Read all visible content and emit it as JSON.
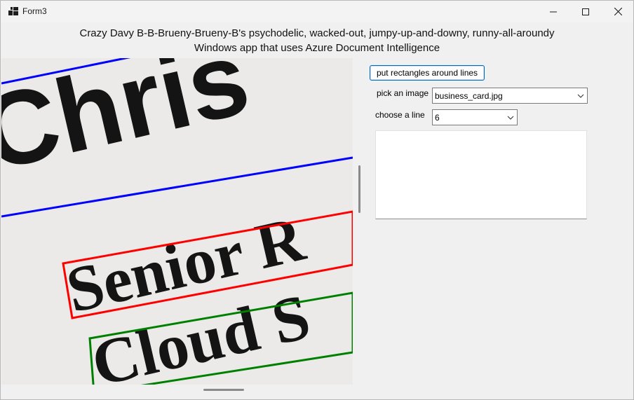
{
  "window": {
    "title": "Form3",
    "icon": "app-window-icon"
  },
  "controls": {
    "minimize": "minimize-icon",
    "maximize": "maximize-icon",
    "close": "close-icon"
  },
  "heading": {
    "line1": "Crazy Davy B-B-Brueny-Brueny-B's psychodelic, wacked-out, jumpy-up-and-downy, runny-all-aroundy",
    "line2": "Windows app that uses Azure Document Intelligence"
  },
  "image_preview": {
    "lines": [
      "Chris",
      "Senior R",
      "Cloud S"
    ],
    "colors": {
      "line1": "#0000ff",
      "line2": "#ff0000",
      "line3": "#008000"
    }
  },
  "actions": {
    "rectangles_button": "put rectangles around lines"
  },
  "image_picker": {
    "label": "pick an image",
    "value": "business_card.jpg"
  },
  "line_picker": {
    "label": "choose a line",
    "value": "6"
  },
  "accent": "#0067c0"
}
